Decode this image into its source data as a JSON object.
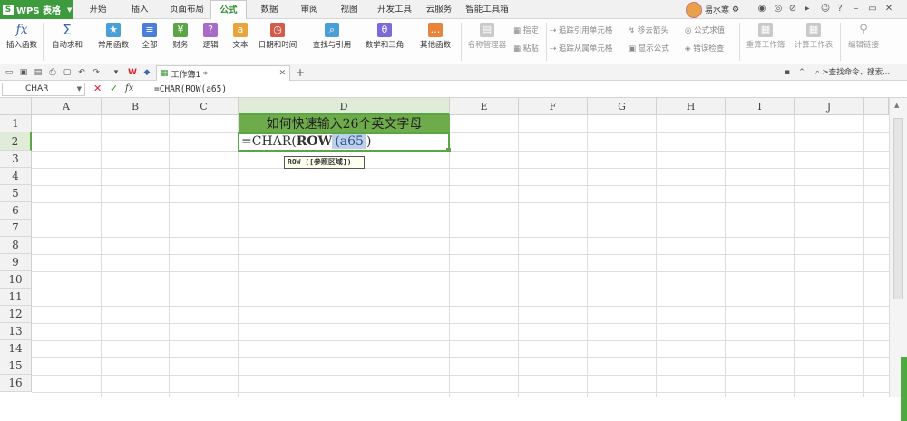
{
  "app": {
    "logo": "S",
    "name": "WPS 表格"
  },
  "menu_tabs": [
    "开始",
    "插入",
    "页面布局",
    "公式",
    "数据",
    "审阅",
    "视图",
    "开发工具",
    "云服务",
    "智能工具箱"
  ],
  "active_tab": "公式",
  "user": {
    "name": "易水寒"
  },
  "ribbon": {
    "insert_function": "插入函数",
    "autosum": "自动求和",
    "common_functions": "常用函数",
    "all": "全部",
    "finance": "财务",
    "logic": "逻辑",
    "text": "文本",
    "datetime": "日期和时间",
    "lookup": "查找与引用",
    "math": "数学和三角",
    "other": "其他函数",
    "name_manager": "名称管理器",
    "specify": "指定",
    "paste": "粘贴",
    "trace_precedents": "追踪引用单元格",
    "trace_dependents": "追踪从属单元格",
    "remove_arrows": "移去箭头",
    "show_formulas": "显示公式",
    "evaluate": "公式求值",
    "error_check": "错误检查",
    "recalc_workbook": "重算工作簿",
    "calc_sheet": "计算工作表",
    "edit_links": "编辑链接"
  },
  "document_tab": "工作簿1 *",
  "search_placeholder": ">查找命令、搜索...",
  "formula_bar": {
    "name_box": "CHAR",
    "fx": "fx",
    "value": "=CHAR(ROW(a65)"
  },
  "columns": [
    "A",
    "B",
    "C",
    "D",
    "E",
    "F",
    "G",
    "H",
    "I",
    "J"
  ],
  "rows": [
    "1",
    "2",
    "3",
    "4",
    "5",
    "6",
    "7",
    "8",
    "9",
    "10",
    "11",
    "12",
    "13",
    "14",
    "15",
    "16"
  ],
  "cells": {
    "D1": "如何快速输入26个英文字母",
    "D2_prefix": "=CHAR(",
    "D2_fn": "ROW",
    "D2_ref": "(a65",
    "D2_suffix": ")"
  },
  "tooltip": "ROW ([参照区域])",
  "colors": {
    "accent": "#5aa647",
    "header_fill": "#6eab4a",
    "ref_highlight": "#bcd0ea"
  }
}
